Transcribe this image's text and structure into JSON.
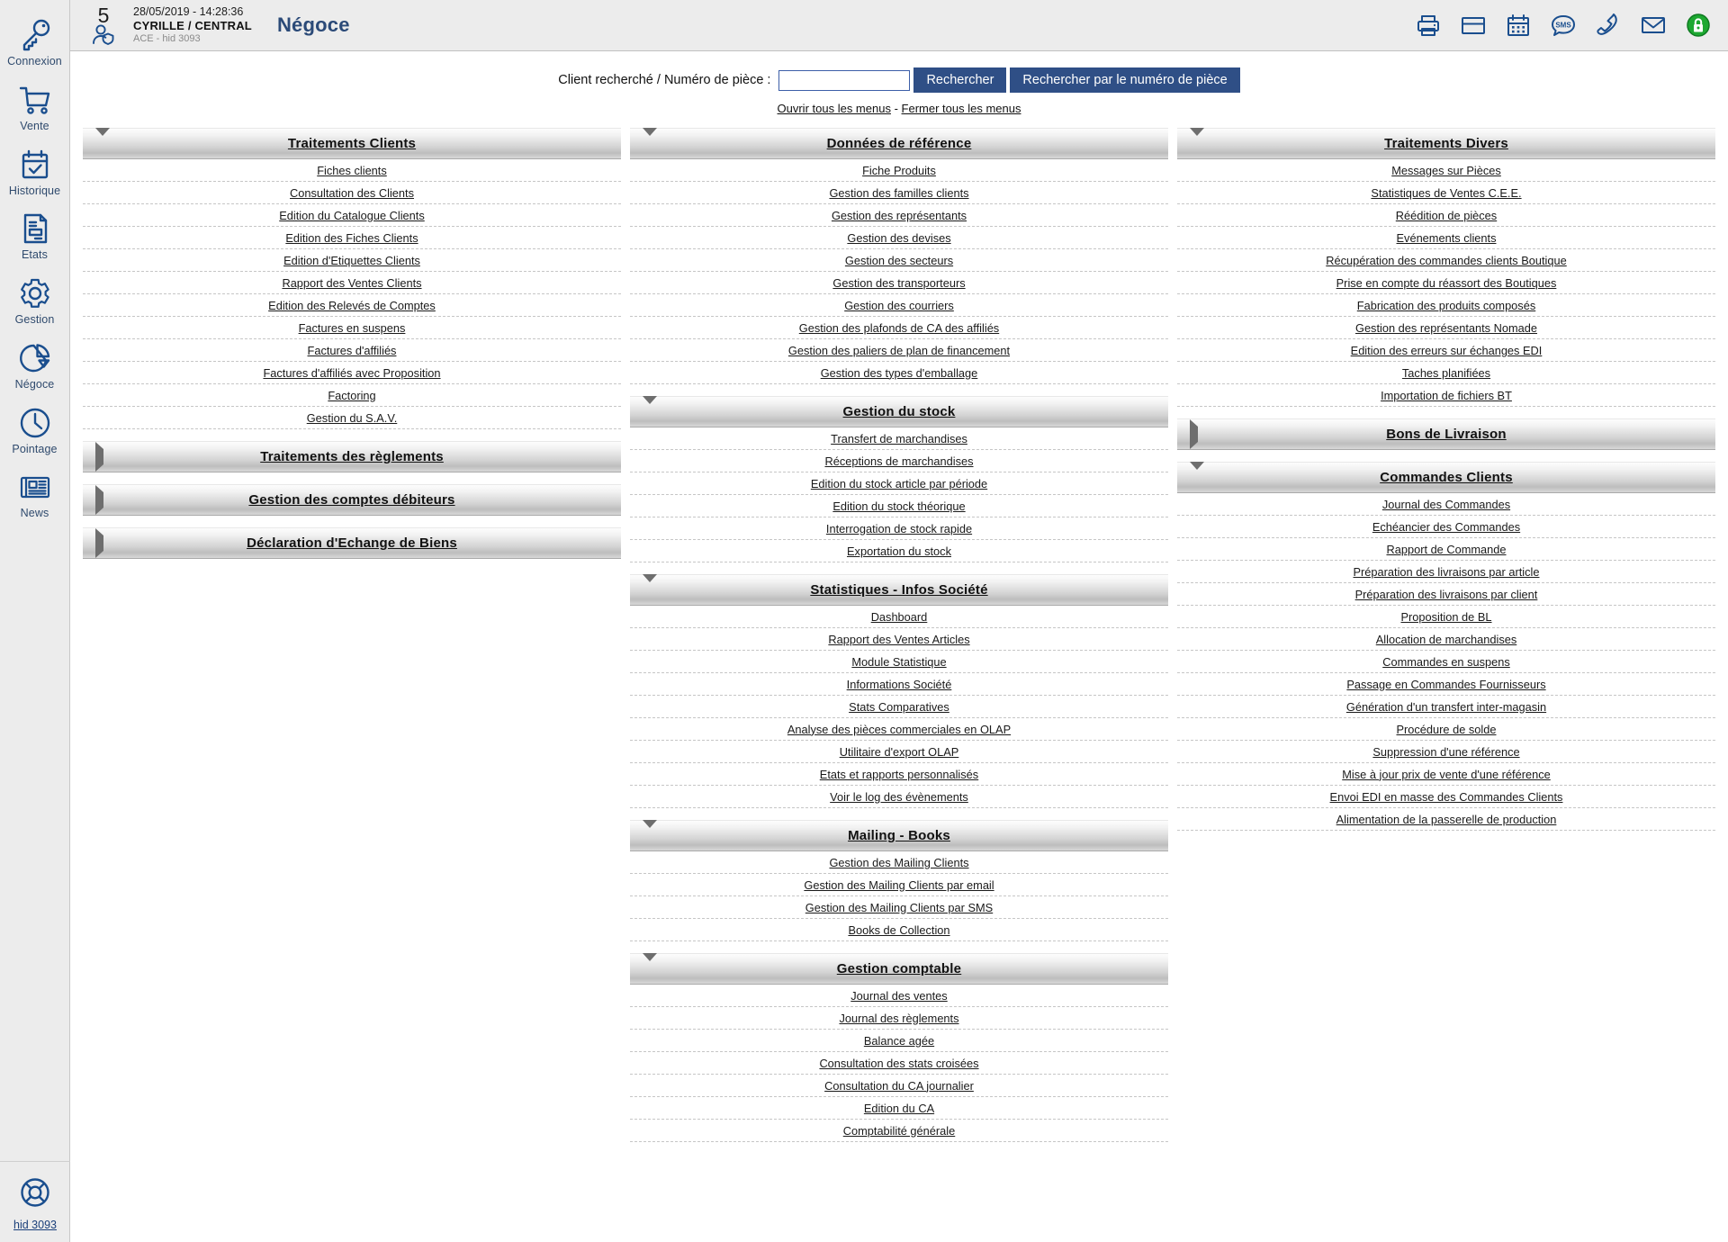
{
  "sidebar": {
    "items": [
      {
        "label": "Connexion",
        "icon": "key-icon"
      },
      {
        "label": "Vente",
        "icon": "cart-icon"
      },
      {
        "label": "Historique",
        "icon": "calendar-check-icon"
      },
      {
        "label": "Etats",
        "icon": "document-icon"
      },
      {
        "label": "Gestion",
        "icon": "gear-icon"
      },
      {
        "label": "Négoce",
        "icon": "pie-chart-icon"
      },
      {
        "label": "Pointage",
        "icon": "clock-icon"
      },
      {
        "label": "News",
        "icon": "newspaper-icon"
      }
    ],
    "bottom": {
      "label": "hid 3093",
      "icon": "lifebuoy-icon"
    }
  },
  "topbar": {
    "count": "5",
    "datetime": "28/05/2019 - 14:28:36",
    "user": "CYRILLE / CENTRAL",
    "subinfo": "ACE - hid 3093",
    "title": "Négoce",
    "icons": [
      "printer-icon",
      "window-icon",
      "calendar-icon",
      "sms-icon",
      "phone-icon",
      "mail-icon",
      "lock-icon"
    ]
  },
  "search": {
    "label": "Client recherché / Numéro de pièce :",
    "value": "",
    "placeholder": "",
    "button_search": "Rechercher",
    "button_search_piece": "Rechercher par le numéro de pièce",
    "open_all": "Ouvrir tous les menus",
    "separator": "-",
    "close_all": "Fermer tous les menus"
  },
  "columns": [
    {
      "panels": [
        {
          "title": "Traitements Clients",
          "expanded": true,
          "items": [
            "Fiches clients",
            "Consultation des Clients",
            "Edition du Catalogue Clients",
            "Edition des Fiches Clients",
            "Edition d'Etiquettes Clients",
            "Rapport des Ventes Clients",
            "Edition des Relevés de Comptes",
            "Factures en suspens",
            "Factures d'affiliés",
            "Factures d'affiliés avec Proposition",
            "Factoring",
            "Gestion du S.A.V."
          ]
        },
        {
          "title": "Traitements des règlements",
          "expanded": false,
          "items": []
        },
        {
          "title": "Gestion des comptes débiteurs",
          "expanded": false,
          "items": []
        },
        {
          "title": "Déclaration d'Echange de Biens",
          "expanded": false,
          "items": []
        }
      ]
    },
    {
      "panels": [
        {
          "title": "Données de référence",
          "expanded": true,
          "items": [
            "Fiche Produits",
            "Gestion des familles clients",
            "Gestion des représentants",
            "Gestion des devises",
            "Gestion des secteurs",
            "Gestion des transporteurs",
            "Gestion des courriers",
            "Gestion des plafonds de CA des affiliés",
            "Gestion des paliers de plan de financement",
            "Gestion des types d'emballage"
          ]
        },
        {
          "title": "Gestion du stock",
          "expanded": true,
          "items": [
            "Transfert de marchandises",
            "Réceptions de marchandises",
            "Edition du stock article par période",
            "Edition du stock théorique",
            "Interrogation de stock rapide",
            "Exportation du stock"
          ]
        },
        {
          "title": "Statistiques - Infos Société",
          "expanded": true,
          "items": [
            "Dashboard",
            "Rapport des Ventes Articles",
            "Module Statistique",
            "Informations Société",
            "Stats Comparatives",
            "Analyse des pièces commerciales en OLAP",
            "Utilitaire d'export OLAP",
            "Etats et rapports personnalisés",
            "Voir le log des évènements"
          ]
        },
        {
          "title": "Mailing - Books",
          "expanded": true,
          "items": [
            "Gestion des Mailing Clients",
            "Gestion des Mailing Clients par email",
            "Gestion des Mailing Clients par SMS",
            "Books de Collection"
          ]
        },
        {
          "title": "Gestion comptable",
          "expanded": true,
          "items": [
            "Journal des ventes",
            "Journal des règlements",
            "Balance agée",
            "Consultation des stats croisées",
            "Consultation du CA journalier",
            "Edition du CA",
            "Comptabilité générale"
          ]
        }
      ]
    },
    {
      "panels": [
        {
          "title": "Traitements Divers",
          "expanded": true,
          "items": [
            "Messages sur Pièces",
            "Statistiques de Ventes C.E.E.",
            "Réédition de pièces",
            "Evénements clients",
            "Récupération des commandes clients Boutique",
            "Prise en compte du réassort des Boutiques",
            "Fabrication des produits composés",
            "Gestion des représentants Nomade",
            "Edition des erreurs sur échanges EDI",
            "Taches planifiées",
            "Importation de fichiers BT"
          ]
        },
        {
          "title": "Bons de Livraison",
          "expanded": false,
          "items": []
        },
        {
          "title": "Commandes Clients",
          "expanded": true,
          "items": [
            "Journal des Commandes",
            "Echéancier des Commandes",
            "Rapport de Commande",
            "Préparation des livraisons par article",
            "Préparation des livraisons par client",
            "Proposition de BL",
            "Allocation de marchandises",
            "Commandes en suspens",
            "Passage en Commandes Fournisseurs",
            "Génération d'un transfert inter-magasin",
            "Procédure de solde",
            "Suppression d'une référence",
            "Mise à jour prix de vente d'une référence",
            "Envoi EDI en masse des Commandes Clients",
            "Alimentation de la passerelle de production"
          ]
        }
      ]
    }
  ],
  "colors": {
    "brand": "#2b4a78",
    "button": "#2f4f86",
    "sidebar_bg": "#ececec",
    "accent_green": "#1da831"
  }
}
